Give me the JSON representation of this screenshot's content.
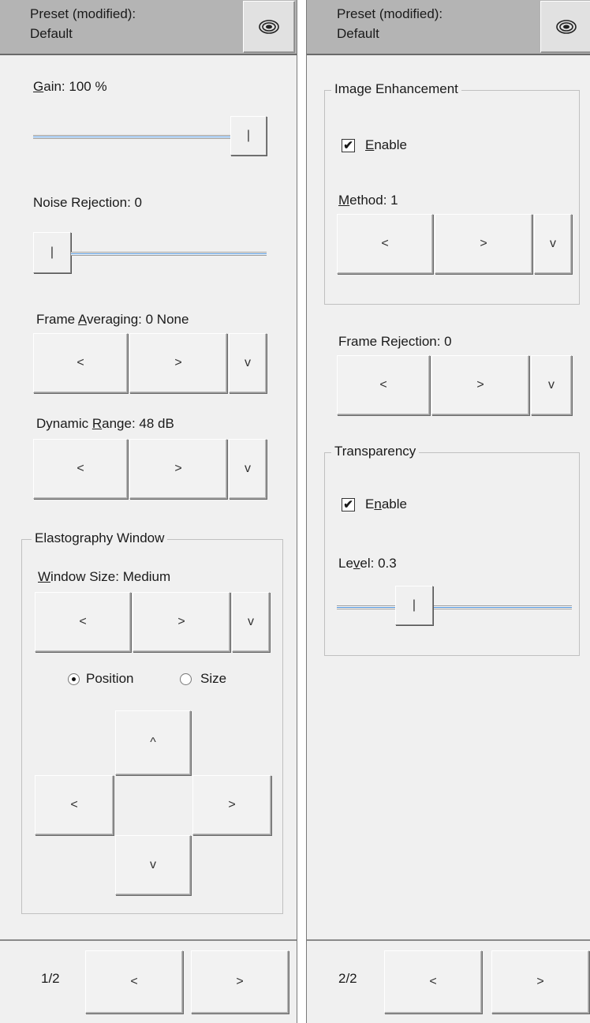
{
  "panel1": {
    "preset_line1": "Preset (modified):",
    "preset_line2": "Default",
    "gain": {
      "accel": "G",
      "rest": "ain: 100 %",
      "level": 1.0
    },
    "noise": {
      "pre": "Noise Re",
      "accel": "j",
      "post": "ection: 0",
      "level": 0.0
    },
    "frame_averaging": {
      "pre": "Frame ",
      "accel": "A",
      "post": "veraging: 0 None"
    },
    "dynamic_range": {
      "pre": "Dynamic ",
      "accel": "R",
      "post": "ange: 48 dB"
    },
    "elasto": {
      "title": "Elastography Window",
      "window_size": {
        "accel": "W",
        "rest": "indow Size: Medium"
      },
      "radio_position": "Position",
      "radio_size": "Size",
      "selected": "Position"
    },
    "nav": {
      "up": "^",
      "left": "<",
      "right": ">",
      "down": "v"
    },
    "page": "1/2"
  },
  "panel2": {
    "preset_line1": "Preset (modified):",
    "preset_line2": "Default",
    "image_enh": {
      "title": "Image Enhancement",
      "enable": {
        "accel": "E",
        "rest": "nable",
        "checked": true
      },
      "method": {
        "accel": "M",
        "rest": "ethod: 1"
      }
    },
    "frame_rejection": {
      "pre": "Frame Re",
      "accel": "j",
      "post": "ection: 0"
    },
    "transparency": {
      "title": "Transparency",
      "enable": {
        "pre": "E",
        "accel": "n",
        "post": "able",
        "checked": true
      },
      "level": {
        "pre": "Le",
        "accel": "v",
        "post": "el: 0.3",
        "value": 0.3
      }
    },
    "page": "2/2"
  },
  "buttons": {
    "prev": "<",
    "next": ">",
    "dropdown": "v"
  },
  "slider_thumb": "|",
  "check_mark": "✔",
  "icons": {
    "preset": "layers-icon"
  },
  "colors": {
    "header_bg": "#b4b4b4",
    "panel_bg": "#f0f0f0",
    "slider_accent": "#4a8fd8"
  }
}
